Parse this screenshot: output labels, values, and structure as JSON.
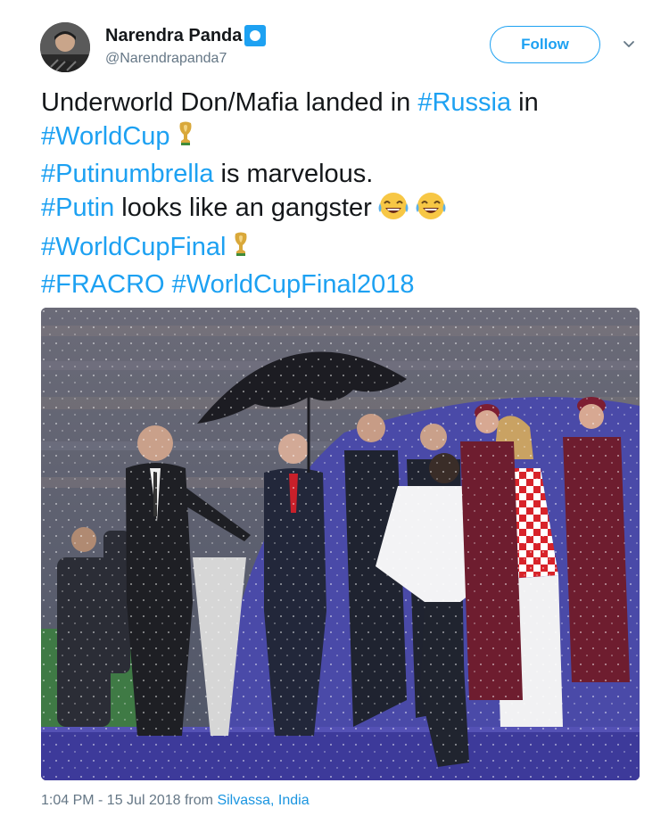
{
  "author": {
    "name": "Narendra Panda",
    "handle": "@Narendrapanda7",
    "verified": true,
    "avatar_icon": "avatar-photo"
  },
  "follow_label": "Follow",
  "menu_icon": "chevron-down-icon",
  "tweet": {
    "lines": [
      [
        {
          "t": "text",
          "v": "Underworld Don/Mafia landed in "
        },
        {
          "t": "tag",
          "v": "#Russia"
        },
        {
          "t": "text",
          "v": " in"
        }
      ],
      [
        {
          "t": "tag",
          "v": "#WorldCup"
        },
        {
          "t": "trophy"
        }
      ],
      [
        {
          "t": "tag",
          "v": "#Putinumbrella"
        },
        {
          "t": "text",
          "v": " is marvelous."
        }
      ],
      [
        {
          "t": "tag",
          "v": "#Putin"
        },
        {
          "t": "text",
          "v": " looks like an gangster"
        },
        {
          "t": "emoji"
        },
        {
          "t": "emoji"
        }
      ],
      [
        {
          "t": "tag",
          "v": "#WorldCupFinal"
        },
        {
          "t": "trophy"
        }
      ],
      [
        {
          "t": "tag",
          "v": "#FRACRO"
        },
        {
          "t": "text",
          "v": " "
        },
        {
          "t": "tag",
          "v": "#WorldCupFinal2018"
        }
      ]
    ]
  },
  "photo_icon": "world-cup-ceremony-photo",
  "footer": {
    "timestamp": "1:04 PM - 15 Jul 2018 from ",
    "location": "Silvassa, India"
  },
  "colors": {
    "link": "#1da1f2",
    "text": "#14171a",
    "muted": "#657786"
  }
}
